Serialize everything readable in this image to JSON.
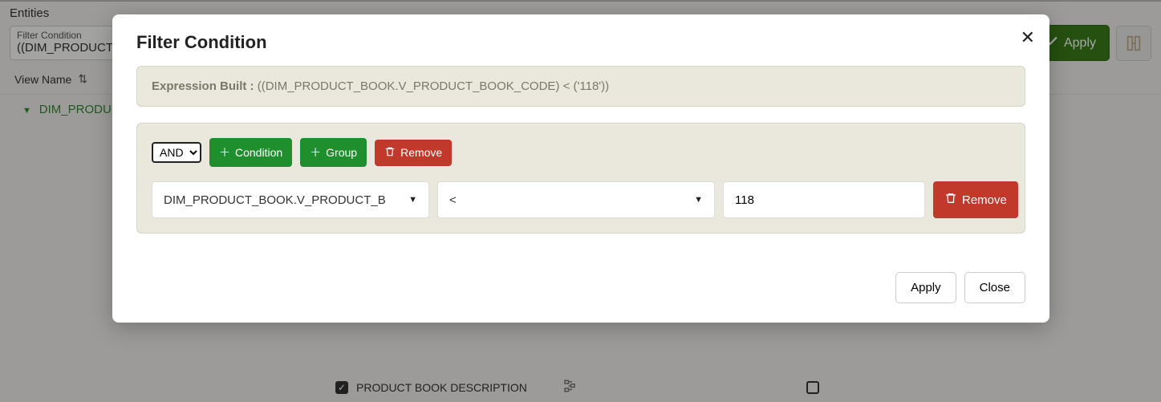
{
  "page": {
    "header": "Entities",
    "filter_field_label": "Filter Condition",
    "filter_field_value": "((DIM_PRODUCT",
    "apply_button": "Apply",
    "view_name_label": "View Name",
    "tree_item": "DIM_PRODU",
    "bottom_item_label": "PRODUCT BOOK DESCRIPTION"
  },
  "modal": {
    "title": "Filter Condition",
    "expr_label": "Expression Built :",
    "expr_value": "((DIM_PRODUCT_BOOK.V_PRODUCT_BOOK_CODE) < ('118'))",
    "andor_value": "AND",
    "condition_button": "Condition",
    "group_button": "Group",
    "remove_button": "Remove",
    "field_select_value": "DIM_PRODUCT_BOOK.V_PRODUCT_B",
    "operator_select_value": "<",
    "value_input": "118",
    "row_remove_button": "Remove",
    "apply_button": "Apply",
    "close_button": "Close"
  }
}
